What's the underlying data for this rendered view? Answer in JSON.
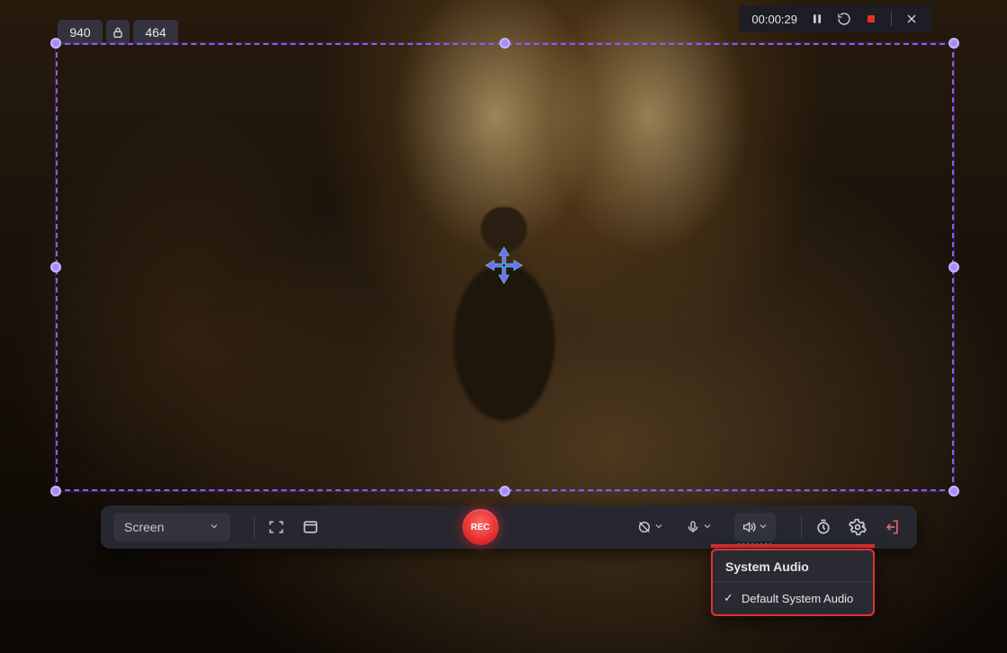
{
  "capture": {
    "width": "940",
    "height": "464"
  },
  "topbar": {
    "timer": "00:00:29"
  },
  "controls": {
    "screen_label": "Screen",
    "rec_label": "REC"
  },
  "audio_menu": {
    "title": "System Audio",
    "option_default": "Default System Audio"
  }
}
